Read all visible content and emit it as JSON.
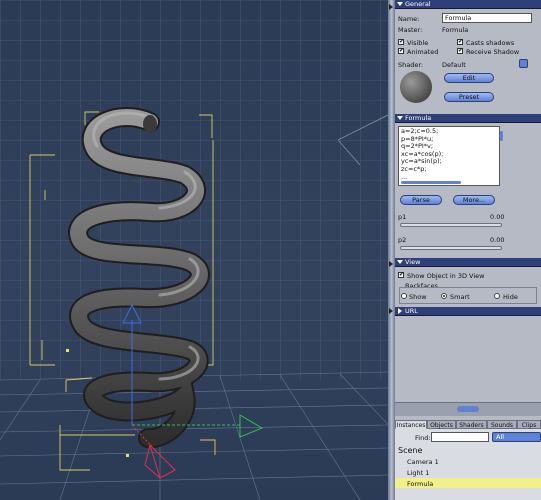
{
  "general": {
    "title": "General",
    "name_label": "Name:",
    "name_value": "Formula",
    "master_label": "Master:",
    "master_value": "Formula",
    "visible": "Visible",
    "animated": "Animated",
    "casts_shadows": "Casts shadows",
    "receive_shadow": "Receive Shadow",
    "shader_label": "Shader:",
    "shader_value": "Default",
    "edit_button": "Edit",
    "preset_button": "Preset",
    "check_mark": "✔"
  },
  "formula": {
    "title": "Formula",
    "code_lines": [
      "a=2;c=0.5;",
      "  p=8*PI*u;",
      "  q=2*PI*v;",
      "  xc=a*cos(p);",
      "  yc=a*sin(p);",
      "  zc=c*p;",
      "  ..."
    ],
    "parse_button": "Parse",
    "more_button": "More...",
    "p1_label": "p1",
    "p1_value": "0.00",
    "p2_label": "p2",
    "p2_value": "0.00"
  },
  "view": {
    "title": "View",
    "show_in_3d": "Show Object in 3D View",
    "backfaces_label": "Backfaces",
    "show": "Show",
    "smooth": "Smart",
    "hide": "Hide"
  },
  "url": {
    "title": "URL"
  },
  "browser": {
    "tabs": [
      "Instances",
      "Objects",
      "Shaders",
      "Sounds",
      "Clips"
    ],
    "find_label": "Find:",
    "find_value": "",
    "filter_value": "All",
    "scene_label": "Scene",
    "items": [
      "Camera 1",
      "Light 1",
      "Formula"
    ]
  },
  "colors": {
    "panel_bg": "#b5bac4",
    "section_header": "#2f3f7a",
    "selected_item": "#f2f08a",
    "viewport_bg": "#2b3a55"
  }
}
